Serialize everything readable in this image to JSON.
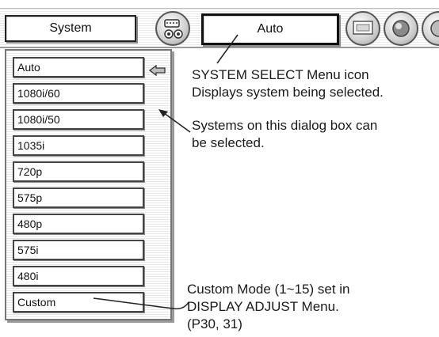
{
  "menubar": {
    "system_label": "System",
    "auto_label": "Auto",
    "icons": [
      "system-select-icon",
      "pc-adjust-icon",
      "image-select-icon",
      "image-adjust-icon"
    ]
  },
  "system_list": {
    "items": [
      "Auto",
      "1080i/60",
      "1080i/50",
      "1035i",
      "720p",
      "575p",
      "480p",
      "575i",
      "480i",
      "Custom"
    ],
    "selected_marker_icon": "left-arrow-icon"
  },
  "annotations": {
    "menu_icon_title": "SYSTEM SELECT Menu icon",
    "menu_icon_desc": "Displays system being selected.",
    "dialog_line1": "Systems on this dialog box can",
    "dialog_line2": "be selected.",
    "custom_line1": "Custom Mode (1~15) set in",
    "custom_line2": "DISPLAY ADJUST Menu.",
    "custom_line3": "(P30, 31)"
  }
}
